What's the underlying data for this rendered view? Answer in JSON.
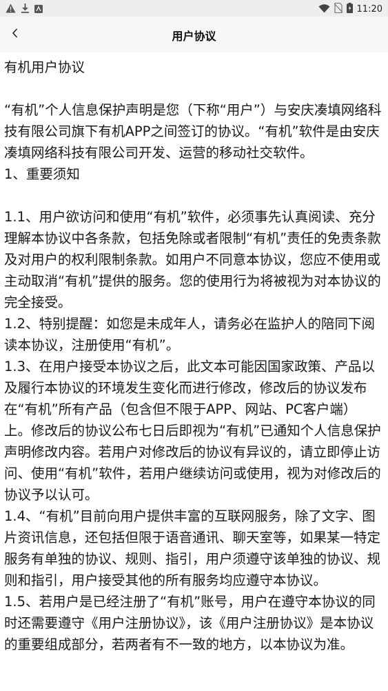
{
  "status_bar": {
    "time": "11:20",
    "left_icons": [
      "alert-icon",
      "download-icon",
      "app-icon"
    ],
    "right_icons": [
      "wifi-icon",
      "no-sim-icon",
      "battery-icon"
    ]
  },
  "header": {
    "title": "用户协议",
    "back_icon": "chevron-left-icon"
  },
  "document": {
    "title": "有机用户协议",
    "intro": "“有机”个人信息保护声明是您（下称“用户”）与安庆凑填网络科技有限公司旗下有机APP之间签订的协议。“有机”软件是由安庆凑填网络科技有限公司开发、运营的移动社交软件。",
    "section1_heading": "1、重要须知",
    "clauses": [
      "1.1、用户欲访问和使用“有机”软件，必须事先认真阅读、充分理解本协议中各条款，包括免除或者限制“有机”责任的免责条款及对用户的权利限制条款。如用户不同意本协议，您应不使用或主动取消“有机”提供的服务。您的使用行为将被视为对本协议的完全接受。",
      "1.2、特别提醒：如您是未成年人，请务必在监护人的陪同下阅读本协议，注册使用“有机”。",
      "1.3、在用户接受本协议之后，此文本可能因国家政策、产品以及履行本协议的环境发生变化而进行修改，修改后的协议发布在“有机”所有产品（包含但不限于APP、网站、PC客户端）上。修改后的协议公布七日后即视为“有机”已通知个人信息保护声明修改内容。若用户对修改后的协议有异议的，请立即停止访问、使用“有机”软件，若用户继续访问或使用，视为对修改后的协议予以认可。",
      "1.4、“有机”目前向用户提供丰富的互联网服务，除了文字、图片资讯信息，还包括但限于语音通讯、聊天室等，如果某一特定服务有单独的协议、规则、指引，用户须遵守该单独的协议、规则和指引，用户接受其他的所有服务均应遵守本协议。",
      "1.5、若用户是已经注册了“有机”账号，用户在遵守本协议的同时还需要遵守《用户注册协议》，该《用户注册协议》是本协议的重要组成部分，若两者有不一致的地方，以本协议为准。"
    ]
  }
}
